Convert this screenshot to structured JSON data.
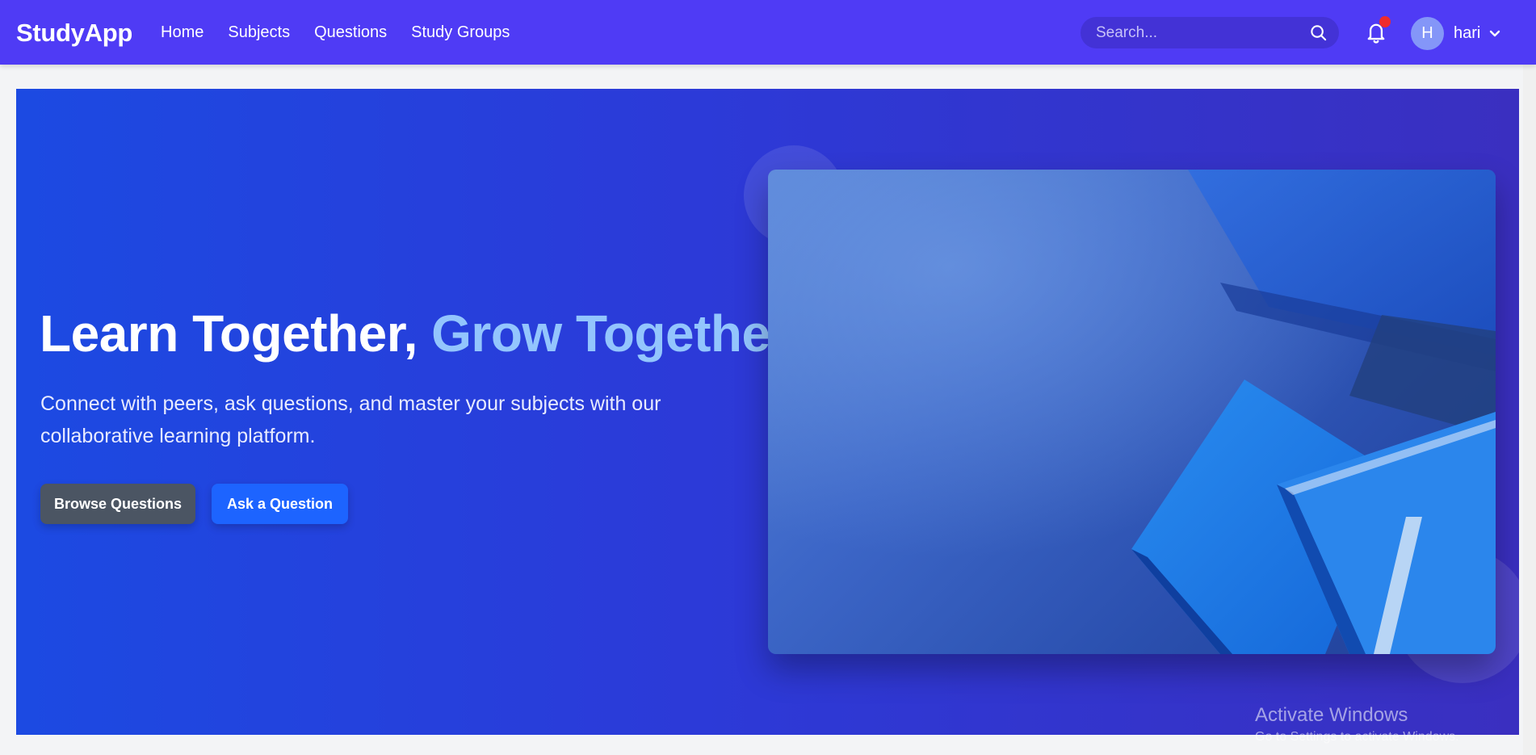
{
  "navbar": {
    "brand": "StudyApp",
    "links": [
      "Home",
      "Subjects",
      "Questions",
      "Study Groups"
    ],
    "search_placeholder": "Search...",
    "user_initial": "H",
    "username": "hari"
  },
  "hero": {
    "title_main": "Learn Together,",
    "title_accent": "Grow Together",
    "subtitle": "Connect with peers, ask questions, and master your subjects with our collaborative learning platform.",
    "browse_button": "Browse Questions",
    "ask_button": "Ask a Question"
  },
  "watermark": {
    "title": "Activate Windows",
    "subtitle": "Go to Settings to activate Windows."
  },
  "colors": {
    "navbar": "#4f3bf5",
    "hero_start": "#1c4ae2",
    "hero_end": "#3a2fc0",
    "accent_text": "#93c5fd",
    "browse_button": "#4b5563",
    "ask_button": "#1d64ff",
    "notification_dot": "#ef2b2b"
  },
  "icons": {
    "search": "search-icon",
    "notifications": "bell-icon",
    "user_menu": "chevron-down-icon"
  }
}
